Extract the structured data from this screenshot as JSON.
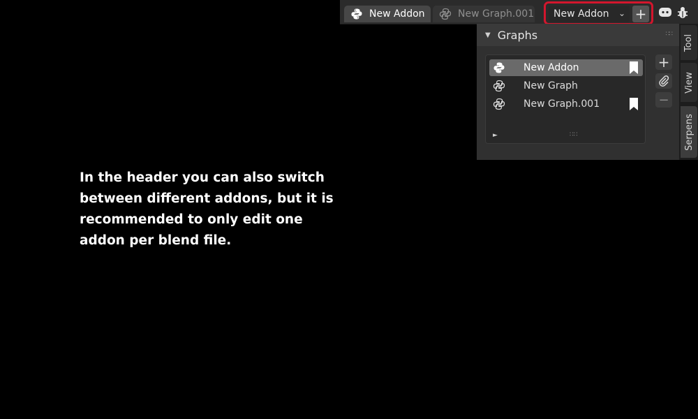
{
  "header": {
    "tabs": [
      {
        "label": "New Addon",
        "icon": "python-icon",
        "active": true
      },
      {
        "label": "New Graph.001",
        "icon": "python-icon",
        "active": false
      }
    ],
    "addon_selector": {
      "value": "New Addon",
      "chevron": "chevron-down-icon"
    },
    "add_addon_symbol": "+",
    "icons": [
      "discord-icon",
      "bug-icon"
    ],
    "highlight_color": "#d3162d"
  },
  "panel": {
    "title": "Graphs",
    "items": [
      {
        "label": "New Addon",
        "icon": "python-icon",
        "selected": true,
        "bookmarked": true
      },
      {
        "label": "New Graph",
        "icon": "python-icon",
        "selected": false,
        "bookmarked": false
      },
      {
        "label": "New Graph.001",
        "icon": "python-icon",
        "selected": false,
        "bookmarked": true
      }
    ],
    "side_buttons": {
      "add": "+",
      "remove": "−",
      "attach_icon": "paperclip-icon"
    }
  },
  "vertical_tabs": [
    "Tool",
    "View",
    "Serpens"
  ],
  "caption": "In the header you can also switch between different addons, but it is recommended to only edit one addon per blend file."
}
